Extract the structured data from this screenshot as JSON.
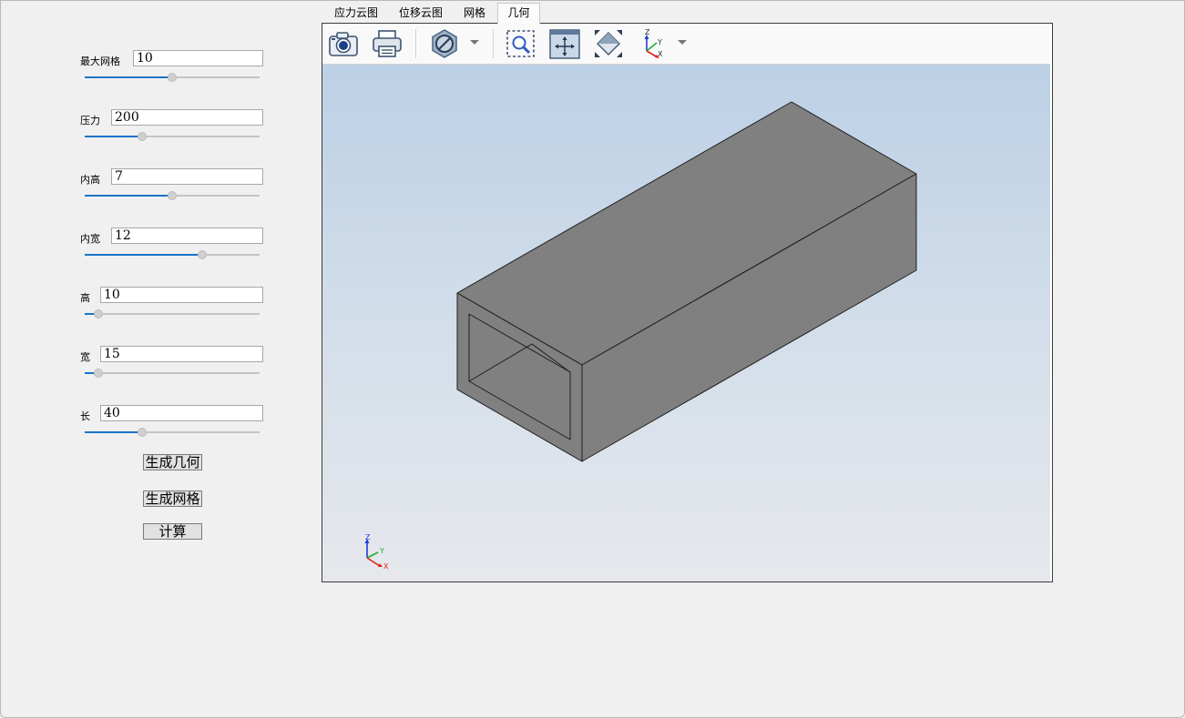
{
  "params": [
    {
      "key": "max_mesh",
      "label": "最大网格",
      "value": "10",
      "slider": 0.5
    },
    {
      "key": "pressure",
      "label": "压力",
      "value": "200",
      "slider": 0.33
    },
    {
      "key": "inner_height",
      "label": "内高",
      "value": "7",
      "slider": 0.5
    },
    {
      "key": "inner_width",
      "label": "内宽",
      "value": "12",
      "slider": 0.67
    },
    {
      "key": "height",
      "label": "高",
      "value": "10",
      "slider": 0.08
    },
    {
      "key": "width",
      "label": "宽",
      "value": "15",
      "slider": 0.08
    },
    {
      "key": "length",
      "label": "长",
      "value": "40",
      "slider": 0.33
    }
  ],
  "buttons": {
    "generate_geometry": "生成几何",
    "generate_mesh": "生成网格",
    "compute": "计算"
  },
  "tabs": [
    {
      "label": "应力云图",
      "active": false
    },
    {
      "label": "位移云图",
      "active": false
    },
    {
      "label": "网格",
      "active": false
    },
    {
      "label": "几何",
      "active": true
    }
  ],
  "toolbar": {
    "icons": [
      "camera-icon",
      "printer-icon",
      "display-mode-icon",
      "zoom-window-icon",
      "pan-icon",
      "fit-all-icon",
      "view-axes-icon"
    ]
  },
  "triad": {
    "x": "X",
    "y": "Y",
    "z": "Z"
  },
  "colors": {
    "accent": "#1a73c8",
    "model_face": "#808080",
    "viewport_top": "#bcd0e6",
    "viewport_bottom": "#e6e8ec",
    "axis_x": "#e0201c",
    "axis_y": "#1fae27",
    "axis_z": "#1f3fd6"
  }
}
